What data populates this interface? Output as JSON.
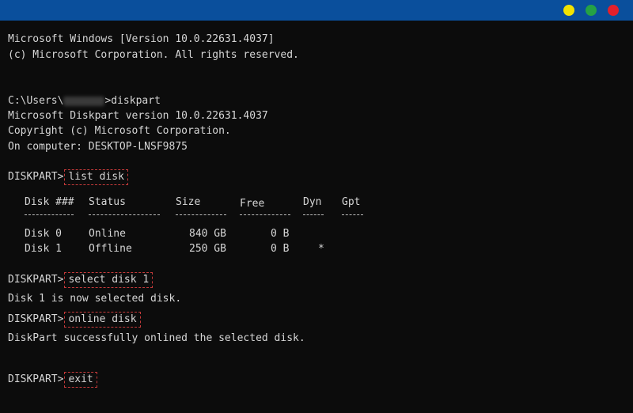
{
  "window": {
    "controls": [
      {
        "name": "yellow",
        "color": "#f2e300"
      },
      {
        "name": "green",
        "color": "#25a245"
      },
      {
        "name": "red",
        "color": "#e3202b"
      }
    ]
  },
  "terminal": {
    "lines": {
      "l1": "Microsoft Windows [Version 10.0.22631.4037]",
      "l2": "(c) Microsoft Corporation. All rights reserved.",
      "path_prefix": "C:\\Users\\",
      "path_suffix": ">diskpart",
      "l4": "Microsoft Diskpart version 10.0.22631.4037",
      "l5": "Copyright (c) Microsoft Corporation.",
      "l6": "On computer: DESKTOP-LNSF9875",
      "prompt": "DISKPART>",
      "cmd1": "list disk",
      "cmd2": "select disk 1",
      "out2": "Disk 1 is now selected disk.",
      "cmd3": "online disk",
      "out3": "DiskPart successfully onlined the selected disk.",
      "cmd4": "exit"
    },
    "table": {
      "headers": {
        "disk": "Disk ###",
        "status": "Status",
        "size": "Size",
        "free": "Free",
        "dyn": "Dyn",
        "gpt": "Gpt"
      },
      "rows": [
        {
          "disk": "Disk 0",
          "status": "Online",
          "size": "840 GB",
          "free": "0 B",
          "dyn": "",
          "gpt": ""
        },
        {
          "disk": "Disk 1",
          "status": "Offline",
          "size": "250 GB",
          "free": "0 B",
          "dyn": "*",
          "gpt": ""
        }
      ]
    }
  }
}
